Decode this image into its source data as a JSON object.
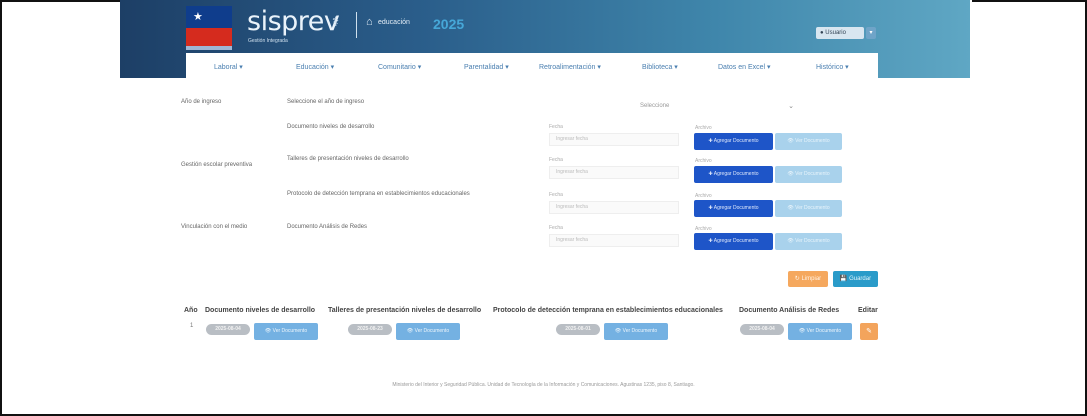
{
  "header": {
    "brand": "sisprev",
    "brand_subtitle": "Gestión Integrada",
    "ministry_glyph": "⚕",
    "edu_label": "educación",
    "year": "2025",
    "user_label": "Usuario"
  },
  "nav": {
    "items": [
      "Laboral",
      "Educación",
      "Comunitario",
      "Parentalidad",
      "Retroalimentación",
      "Biblioteca",
      "Datos en Excel",
      "Histórico"
    ]
  },
  "form": {
    "year_label": "Año de ingreso",
    "year_hint": "Seleccione el año de ingreso",
    "year_select": "Seleccione",
    "section_gestion": "Gestión escolar preventiva",
    "section_vinculacion": "Vinculación con el medio",
    "rows": [
      {
        "doc": "Documento niveles de desarrollo",
        "fecha": "Fecha",
        "placeholder": "Ingresar fecha",
        "archivo": "Archivo",
        "add": "Agregar Documento",
        "view": "Ver Documento"
      },
      {
        "doc": "Talleres de presentación niveles de desarrollo",
        "fecha": "Fecha",
        "placeholder": "Ingresar fecha",
        "archivo": "Archivo",
        "add": "Agregar Documento",
        "view": "Ver Documento"
      },
      {
        "doc": "Protocolo de detección temprana en establecimientos educacionales",
        "fecha": "Fecha",
        "placeholder": "Ingresar fecha",
        "archivo": "Archivo",
        "add": "Agregar Documento",
        "view": "Ver Documento"
      },
      {
        "doc": "Documento Análisis de Redes",
        "fecha": "Fecha",
        "placeholder": "Ingresar fecha",
        "archivo": "Archivo",
        "add": "Agregar Documento",
        "view": "Ver Documento"
      }
    ],
    "clear": "Limpiar",
    "save": "Guardar"
  },
  "table": {
    "headers": [
      "Año",
      "Documento niveles de desarrollo",
      "Talleres de presentación niveles de desarrollo",
      "Protocolo de detección temprana en establecimientos educacionales",
      "Documento Análisis de Redes",
      "Editar"
    ],
    "row": {
      "year": "1",
      "dates": [
        "2025-08-04",
        "2025-08-23",
        "2025-08-01",
        "2025-08-04"
      ],
      "doc_btn": "Ver Documento",
      "edit_icon": "✎"
    }
  },
  "footer": "Ministerio del Interior y Seguridad Pública. Unidad de Tecnología de la Información y Comunicaciones. Agustinas 1235, piso 8, Santiago."
}
